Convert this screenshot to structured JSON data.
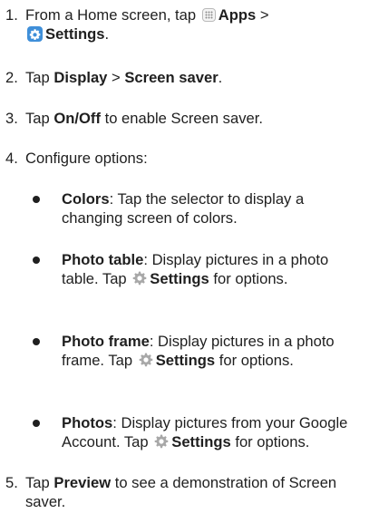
{
  "steps": [
    {
      "num": "1.",
      "pre": "From a Home screen, tap ",
      "apps_label": "Apps",
      "sep": " >",
      "settings_label": "Settings",
      "end": "."
    },
    {
      "num": "2.",
      "pre": "Tap ",
      "display_label": "Display",
      "sep": " > ",
      "screensaver_label": "Screen saver",
      "end": "."
    },
    {
      "num": "3.",
      "pre": "Tap ",
      "onoff_label": "On/Off",
      "post": " to enable Screen saver."
    },
    {
      "num": "4.",
      "text": "Configure options:"
    },
    {
      "num": "5.",
      "pre": "Tap ",
      "preview_label": "Preview",
      "post": " to see a demonstration of Screen saver."
    }
  ],
  "options": [
    {
      "term": "Colors",
      "desc": ": Tap the selector to display a changing screen of colors."
    },
    {
      "term": "Photo table",
      "desc": ": Display pictures in a photo table. Tap ",
      "settings_label": "Settings",
      "end": " for options."
    },
    {
      "term": "Photo frame",
      "desc": ": Display pictures in a photo frame. Tap ",
      "settings_label": "Settings",
      "end": " for options."
    },
    {
      "term": "Photos",
      "desc": ": Display pictures from your Google Account. Tap ",
      "settings_label": "Settings",
      "end": " for options."
    }
  ],
  "icons": {
    "apps": "apps-grid-icon",
    "settings_app": "settings-app-icon",
    "gear": "gear-icon"
  },
  "colors": {
    "settings_app_bg": "#3f8fd9"
  }
}
